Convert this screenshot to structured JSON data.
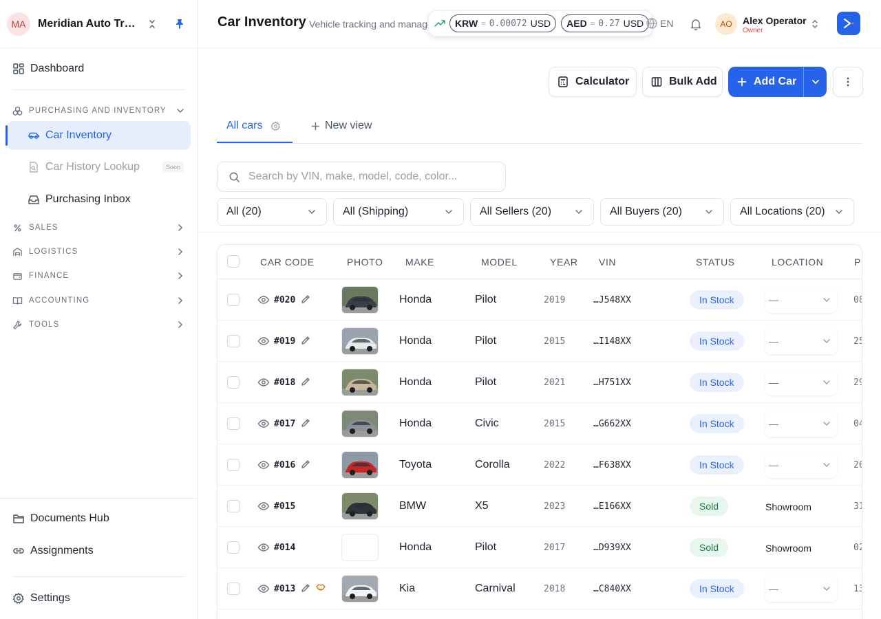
{
  "org": {
    "initials": "MA",
    "name": "Meridian Auto Trading"
  },
  "nav": {
    "dashboard": "Dashboard",
    "groups": {
      "purchasing": "PURCHASING AND INVENTORY",
      "sales": "SALES",
      "logistics": "LOGISTICS",
      "finance": "FINANCE",
      "accounting": "ACCOUNTING",
      "tools": "TOOLS"
    },
    "purchasing_items": [
      {
        "label": "Car Inventory",
        "icon": "car-icon",
        "active": true
      },
      {
        "label": "Car History Lookup",
        "icon": "file-search-icon",
        "badge": "Soon"
      },
      {
        "label": "Purchasing Inbox",
        "icon": "inbox-icon"
      }
    ],
    "bottom": {
      "documents": "Documents Hub",
      "assignments": "Assignments",
      "settings": "Settings"
    }
  },
  "header": {
    "title": "Car Inventory",
    "subtitle": "Vehicle tracking and management",
    "rates": [
      {
        "currency": "KRW",
        "rate": "0.00072",
        "base": "USD"
      },
      {
        "currency": "AED",
        "rate": "0.27",
        "base": "USD"
      }
    ],
    "language": "EN",
    "user": {
      "initials": "AO",
      "name": "Alex Operator",
      "role": "Owner"
    }
  },
  "actions": {
    "calculator": "Calculator",
    "bulk_add": "Bulk Add",
    "add_car": "Add Car"
  },
  "tabs": {
    "all_cars": "All cars",
    "new_view": "New view"
  },
  "search": {
    "placeholder": "Search by VIN, make, model, code, color..."
  },
  "filters": [
    "All (20)",
    "All (Shipping)",
    "All Sellers (20)",
    "All Buyers (20)",
    "All Locations (20)"
  ],
  "table": {
    "columns": [
      "CAR CODE",
      "PHOTO",
      "MAKE",
      "MODEL",
      "YEAR",
      "VIN",
      "STATUS",
      "LOCATION",
      "PU"
    ],
    "rows": [
      {
        "code": "#020",
        "make": "Honda",
        "model": "Pilot",
        "year": "2019",
        "vin": "…J548XX",
        "status": "In Stock",
        "location": "—",
        "pur": "08",
        "editable": true
      },
      {
        "code": "#019",
        "make": "Honda",
        "model": "Pilot",
        "year": "2015",
        "vin": "…I148XX",
        "status": "In Stock",
        "location": "—",
        "pur": "25",
        "editable": true
      },
      {
        "code": "#018",
        "make": "Honda",
        "model": "Pilot",
        "year": "2021",
        "vin": "…H751XX",
        "status": "In Stock",
        "location": "—",
        "pur": "29",
        "editable": true
      },
      {
        "code": "#017",
        "make": "Honda",
        "model": "Civic",
        "year": "2015",
        "vin": "…G662XX",
        "status": "In Stock",
        "location": "—",
        "pur": "04",
        "editable": true
      },
      {
        "code": "#016",
        "make": "Toyota",
        "model": "Corolla",
        "year": "2022",
        "vin": "…F638XX",
        "status": "In Stock",
        "location": "—",
        "pur": "26",
        "editable": true
      },
      {
        "code": "#015",
        "make": "BMW",
        "model": "X5",
        "year": "2023",
        "vin": "…E166XX",
        "status": "Sold",
        "location": "Showroom",
        "pur": "31",
        "editable": false
      },
      {
        "code": "#014",
        "make": "Honda",
        "model": "Pilot",
        "year": "2017",
        "vin": "…D939XX",
        "status": "Sold",
        "location": "Showroom",
        "pur": "02",
        "editable": false
      },
      {
        "code": "#013",
        "make": "Kia",
        "model": "Carnival",
        "year": "2018",
        "vin": "…C840XX",
        "status": "In Stock",
        "location": "—",
        "pur": "13",
        "editable": true
      }
    ]
  }
}
